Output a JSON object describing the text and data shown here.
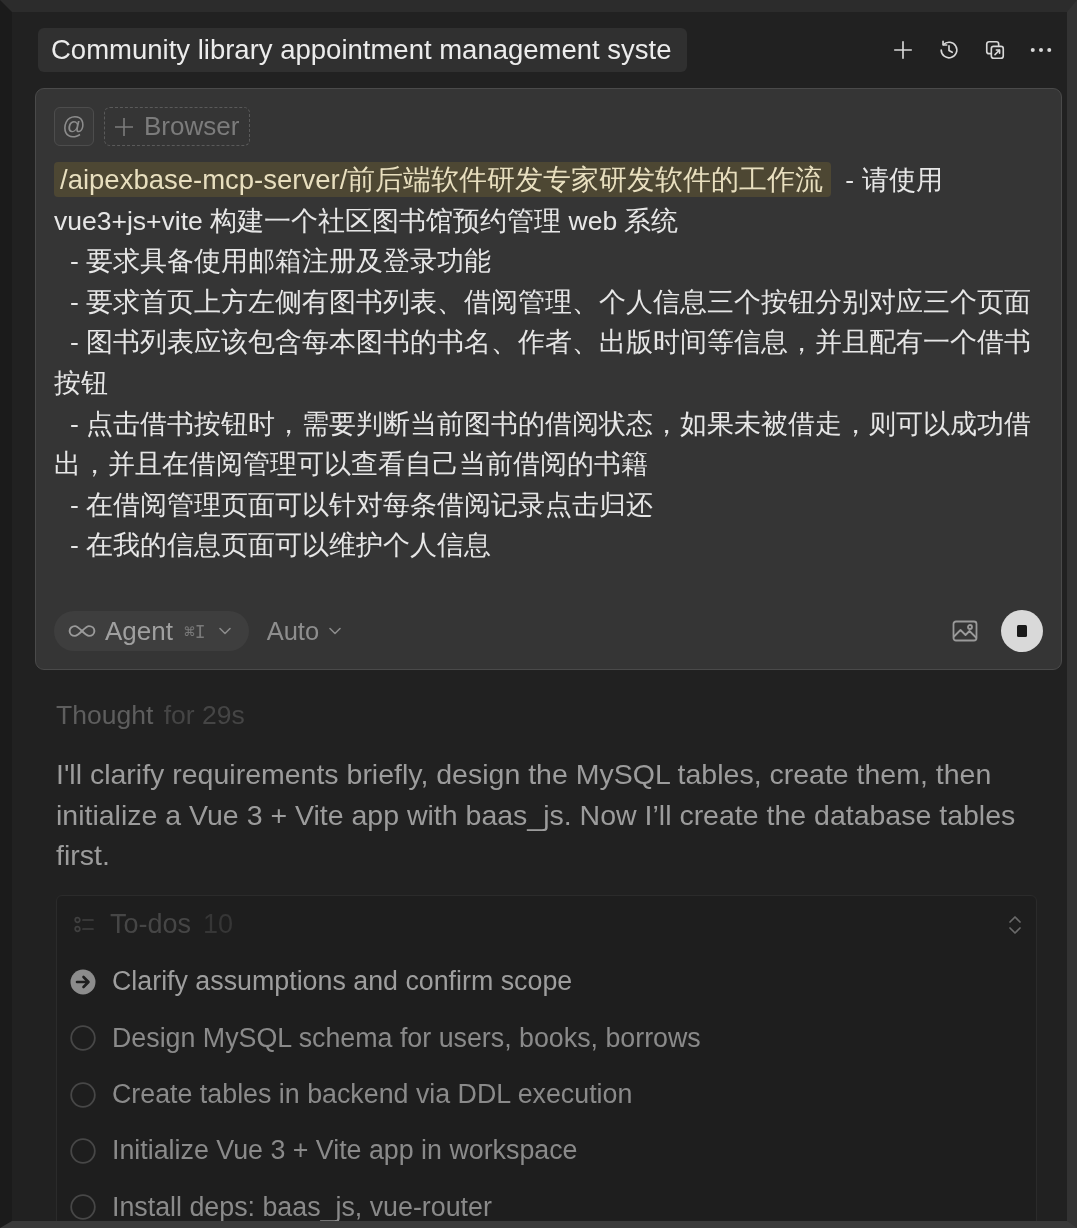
{
  "header": {
    "title": "Community library appointment management syste"
  },
  "composer": {
    "mention_button": "@",
    "browser_button": "Browser",
    "prompt": {
      "mention": "/aipexbase-mcp-server/前后端软件研发专家研发软件的工作流",
      "after_mention": "- 请使用",
      "continuation": "vue3+js+vite 构建一个社区图书馆预约管理 web 系统",
      "lines": [
        "- 要求具备使用邮箱注册及登录功能",
        "- 要求首页上方左侧有图书列表、借阅管理、个人信息三个按钮分别对应三个页面",
        "- 图书列表应该包含每本图书的书名、作者、出版时间等信息，并且配有一个借书按钮",
        "- 点击借书按钮时，需要判断当前图书的借阅状态，如果未被借走，则可以成功借出，并且在借阅管理可以查看自己当前借阅的书籍",
        "- 在借阅管理页面可以针对每条借阅记录点击归还",
        "- 在我的信息页面可以维护个人信息"
      ]
    },
    "mode": {
      "label": "Agent",
      "shortcut": "⌘I"
    },
    "model": {
      "label": "Auto"
    }
  },
  "thought": {
    "label": "Thought",
    "duration": "for 29s"
  },
  "message": "I'll clarify requirements briefly, design the MySQL tables, create them, then initialize a Vue 3 + Vite app with baas_js. Now I’ll create the database tables first.",
  "todos": {
    "title": "To-dos",
    "count": "10",
    "items": [
      {
        "text": "Clarify assumptions and confirm scope",
        "kind": "current"
      },
      {
        "text": "Design MySQL schema for users, books, borrows",
        "kind": "pending"
      },
      {
        "text": "Create tables in backend via DDL execution",
        "kind": "pending"
      },
      {
        "text": "Initialize Vue 3 + Vite app in workspace",
        "kind": "pending"
      },
      {
        "text": "Install deps: baas_js, vue-router",
        "kind": "pending"
      }
    ]
  }
}
